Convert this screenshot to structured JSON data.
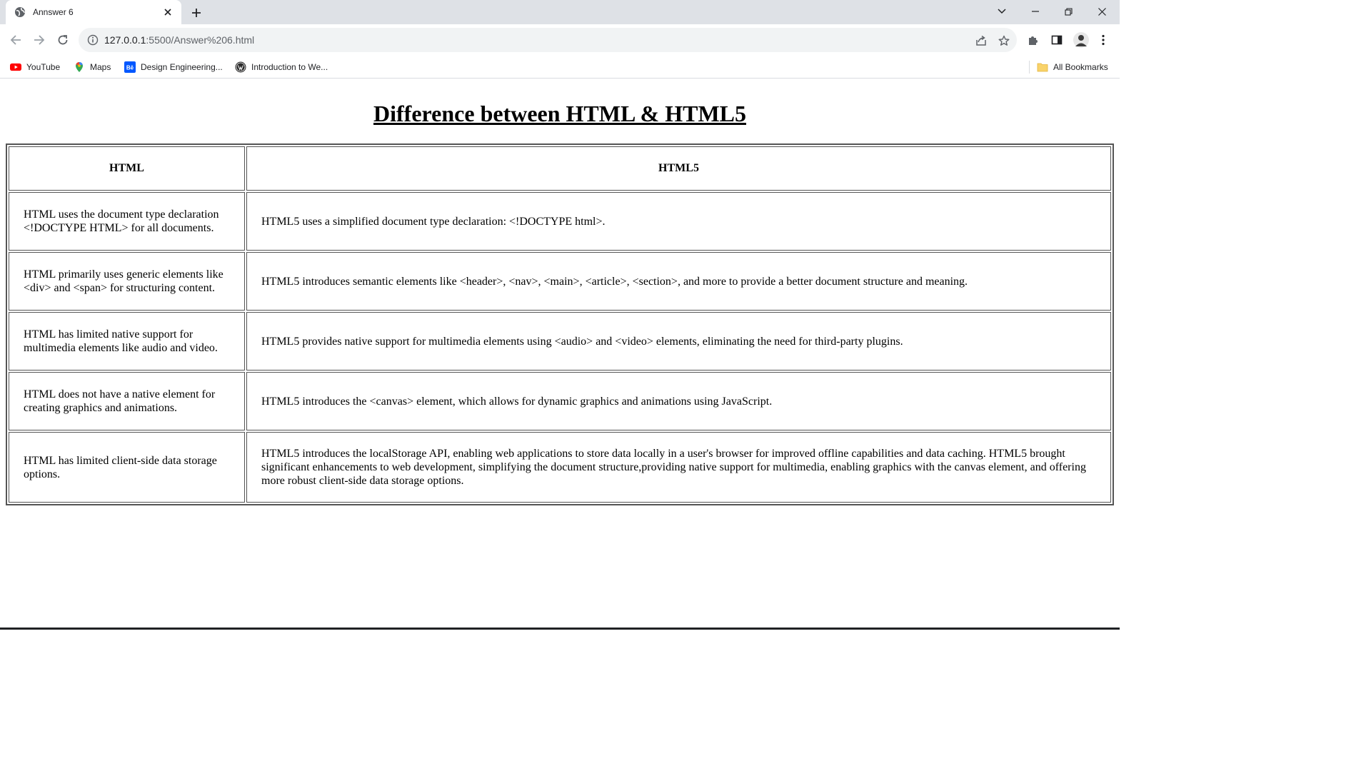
{
  "browser": {
    "tab": {
      "title": "Annswer 6"
    },
    "url": {
      "host": "127.0.0.1",
      "path": ":5500/Answer%206.html"
    },
    "bookmarks": [
      {
        "label": "YouTube",
        "icon": "youtube-icon"
      },
      {
        "label": "Maps",
        "icon": "maps-pin-icon"
      },
      {
        "label": "Design Engineering...",
        "icon": "behance-icon"
      },
      {
        "label": "Introduction to We...",
        "icon": "wordpress-icon"
      }
    ],
    "all_bookmarks_label": "All Bookmarks"
  },
  "page": {
    "title": "Difference between HTML & HTML5",
    "table": {
      "headers": [
        "HTML",
        "HTML5"
      ],
      "rows": [
        [
          "HTML uses the document type declaration <!DOCTYPE HTML> for all documents.",
          "HTML5 uses a simplified document type declaration: <!DOCTYPE html>."
        ],
        [
          "HTML primarily uses generic elements like <div> and <span> for structuring content.",
          "HTML5 introduces semantic elements like <header>, <nav>, <main>, <article>, <section>, and more to provide a better document structure and meaning."
        ],
        [
          "HTML has limited native support for multimedia elements like audio and video.",
          "HTML5 provides native support for multimedia elements using <audio> and <video> elements, eliminating the need for third-party plugins."
        ],
        [
          "HTML does not have a native element for creating graphics and animations.",
          "HTML5 introduces the <canvas> element, which allows for dynamic graphics and animations using JavaScript."
        ],
        [
          "HTML has limited client-side data storage options.",
          "HTML5 introduces the localStorage API, enabling web applications to store data locally in a user's browser for improved offline capabilities and data caching. HTML5 brought significant enhancements to web development, simplifying the document structure,providing native support for multimedia, enabling graphics with the canvas element, and offering more robust client-side data storage options."
        ]
      ]
    }
  },
  "colors": {
    "tabstrip": "#dee1e6",
    "omnibox": "#f1f3f4",
    "text": "#202124",
    "border": "#555555"
  }
}
